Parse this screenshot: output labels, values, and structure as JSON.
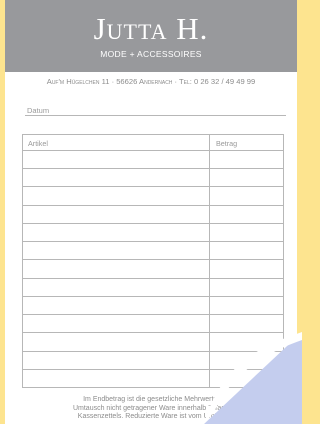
{
  "brand": {
    "name": "Jutta H.",
    "tagline": "MODE + ACCESSOIRES"
  },
  "address": "Auf'm Hügelchen 11 · 56626 Andernach · Tel: 0 26 32 / 49 49 99",
  "form": {
    "date_label": "Datum"
  },
  "table": {
    "headers": [
      "Artikel",
      "Betrag"
    ],
    "empty_rows": 13
  },
  "footer": {
    "lines": [
      "Im Endbetrag ist die gesetzliche Mehrwertst",
      "Umtausch nicht getragener Ware innerhalb 7 Tage",
      "Kassenzettels. Reduzierte Ware ist vom Umtau"
    ]
  },
  "colors": {
    "backing_paper": "#fde48f",
    "header_band": "#98999c",
    "page_curl": "#c4cdee"
  }
}
